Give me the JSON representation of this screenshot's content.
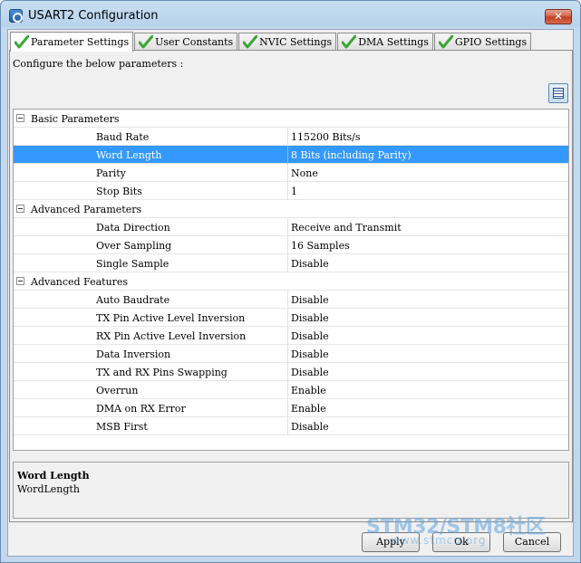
{
  "window": {
    "title": "USART2 Configuration",
    "close_label": "✕"
  },
  "tabs": [
    {
      "label": "Parameter Settings",
      "active": true
    },
    {
      "label": "User Constants",
      "active": false
    },
    {
      "label": "NVIC Settings",
      "active": false
    },
    {
      "label": "DMA Settings",
      "active": false
    },
    {
      "label": "GPIO Settings",
      "active": false
    }
  ],
  "panel": {
    "description": "Configure the below parameters :"
  },
  "groups": [
    {
      "title": "Basic Parameters",
      "params": [
        {
          "name": "Baud Rate",
          "value": "115200 Bits/s"
        },
        {
          "name": "Word Length",
          "value": "8 Bits (including Parity)"
        },
        {
          "name": "Parity",
          "value": "None"
        },
        {
          "name": "Stop Bits",
          "value": "1"
        }
      ]
    },
    {
      "title": "Advanced Parameters",
      "params": [
        {
          "name": "Data Direction",
          "value": "Receive and Transmit"
        },
        {
          "name": "Over Sampling",
          "value": "16 Samples"
        },
        {
          "name": "Single Sample",
          "value": "Disable"
        }
      ]
    },
    {
      "title": "Advanced Features",
      "params": [
        {
          "name": "Auto Baudrate",
          "value": "Disable"
        },
        {
          "name": "TX Pin Active Level Inversion",
          "value": "Disable"
        },
        {
          "name": "RX Pin Active Level Inversion",
          "value": "Disable"
        },
        {
          "name": "Data Inversion",
          "value": "Disable"
        },
        {
          "name": "TX and RX Pins Swapping",
          "value": "Disable"
        },
        {
          "name": "Overrun",
          "value": "Enable"
        },
        {
          "name": "DMA on RX Error",
          "value": "Enable"
        },
        {
          "name": "MSB First",
          "value": "Disable"
        }
      ]
    }
  ],
  "selected_param": "Word Length",
  "description_box": {
    "title": "Word Length",
    "text": "WordLength"
  },
  "buttons": {
    "apply": "Apply",
    "ok": "Ok",
    "cancel": "Cancel"
  },
  "watermark": {
    "main": "STM32/STM8社区",
    "sub": "www.stmcu.org"
  },
  "colors": {
    "selection": "#3399ff",
    "check": "#3aa635"
  }
}
